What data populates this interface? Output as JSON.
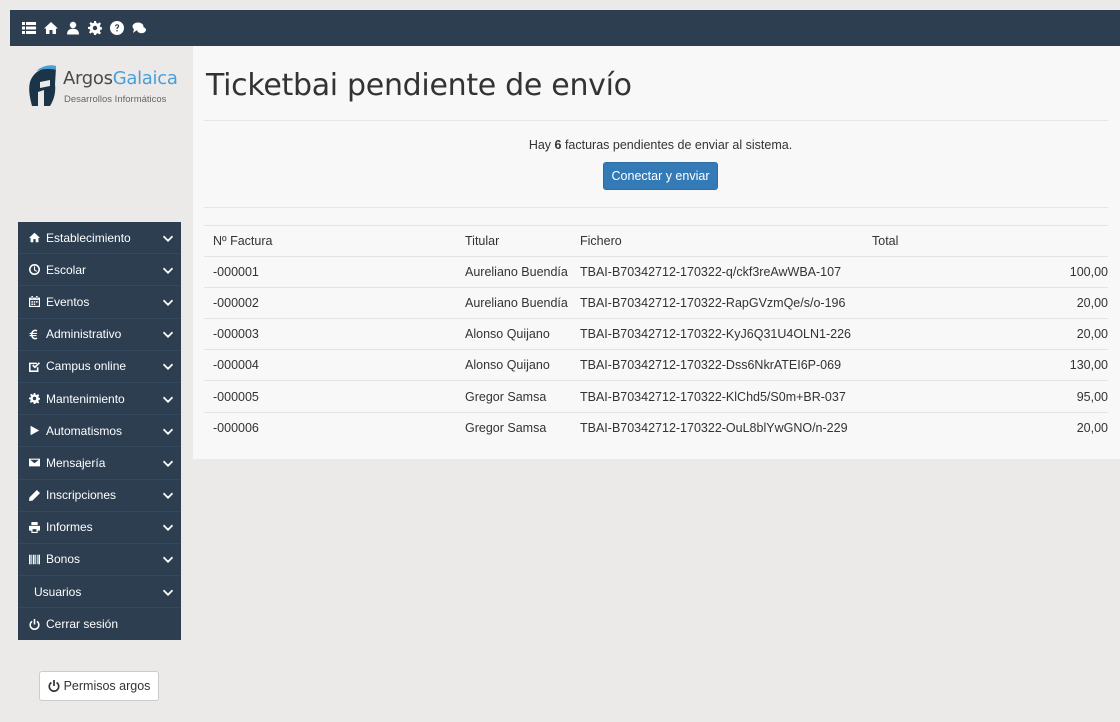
{
  "topbar": {
    "icons": [
      "list-icon",
      "home-icon",
      "user-icon",
      "gear-icon",
      "question-icon",
      "chat-icon"
    ]
  },
  "logo": {
    "brand_part1": "Argos",
    "brand_part2": "Galaica",
    "subtitle": "Desarrollos Informáticos"
  },
  "sidebar": {
    "items": [
      {
        "label": "Establecimiento",
        "icon": "home-icon"
      },
      {
        "label": "Escolar",
        "icon": "dashboard-icon"
      },
      {
        "label": "Eventos",
        "icon": "calendar-icon"
      },
      {
        "label": "Administrativo",
        "icon": "euro-icon"
      },
      {
        "label": "Campus online",
        "icon": "checkbox-icon"
      },
      {
        "label": "Mantenimiento",
        "icon": "gear-icon"
      },
      {
        "label": "Automatismos",
        "icon": "play-icon"
      },
      {
        "label": "Mensajería",
        "icon": "envelope-icon"
      },
      {
        "label": "Inscripciones",
        "icon": "pencil-icon"
      },
      {
        "label": "Informes",
        "icon": "print-icon"
      },
      {
        "label": "Bonos",
        "icon": "barcode-icon"
      },
      {
        "label": "Usuarios",
        "icon": ""
      },
      {
        "label": "Cerrar sesión",
        "icon": "power-icon"
      }
    ]
  },
  "permisos_button": "Permisos argos",
  "page": {
    "title": "Ticketbai pendiente de envío",
    "notice_prefix": "Hay ",
    "notice_count": "6",
    "notice_suffix": " facturas pendientes de enviar al sistema.",
    "send_button": "Conectar y enviar"
  },
  "table": {
    "headers": [
      "Nº Factura",
      "Titular",
      "Fichero",
      "Total"
    ],
    "rows": [
      [
        "-000001",
        "Aureliano Buendía",
        "TBAI-B70342712-170322-q/ckf3reAwWBA-107",
        "100,00"
      ],
      [
        "-000002",
        "Aureliano Buendía",
        "TBAI-B70342712-170322-RapGVzmQe/s/o-196",
        "20,00"
      ],
      [
        "-000003",
        "Alonso Quijano",
        "TBAI-B70342712-170322-KyJ6Q31U4OLN1-226",
        "20,00"
      ],
      [
        "-000004",
        "Alonso Quijano",
        "TBAI-B70342712-170322-Dss6NkrATEI6P-069",
        "130,00"
      ],
      [
        "-000005",
        "Gregor Samsa",
        "TBAI-B70342712-170322-KlChd5/S0m+BR-037",
        "95,00"
      ],
      [
        "-000006",
        "Gregor Samsa",
        "TBAI-B70342712-170322-OuL8blYwGNO/n-229",
        "20,00"
      ]
    ]
  },
  "colors": {
    "navy": "#2c3e50",
    "primary": "#337ab7",
    "brand_blue": "#4a9fd8"
  }
}
